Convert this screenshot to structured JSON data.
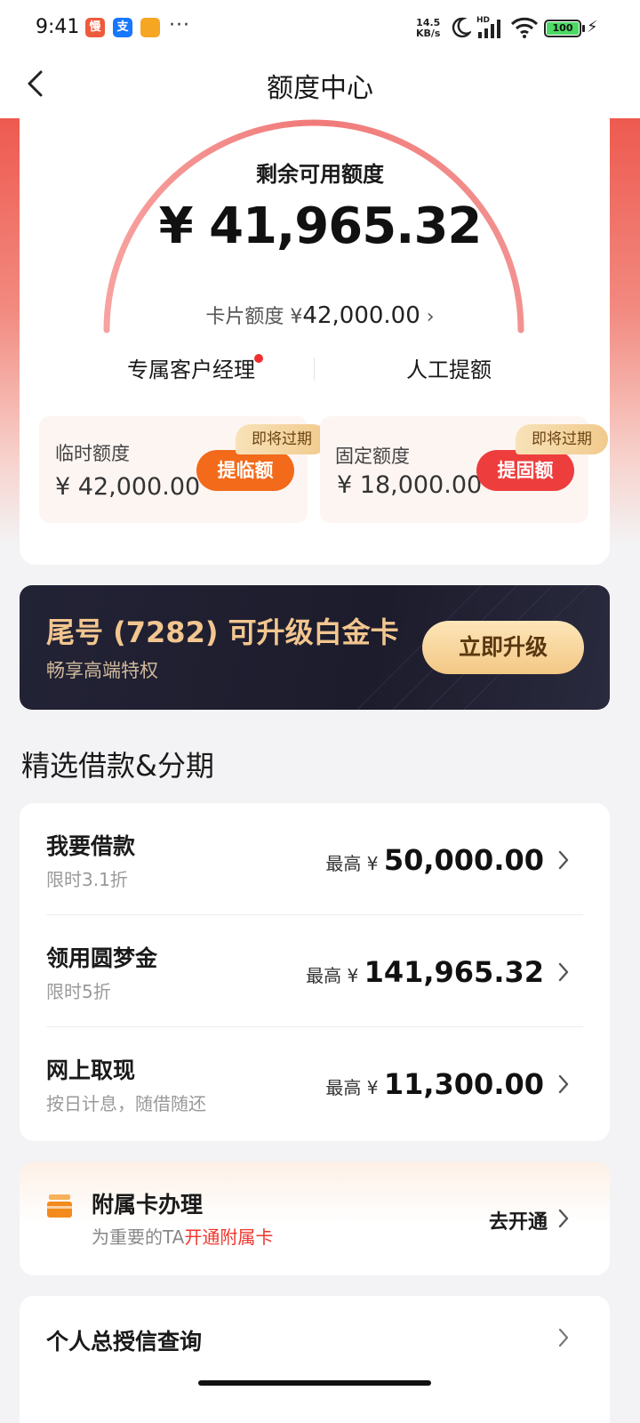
{
  "status_bar": {
    "time": "9:41",
    "apps": [
      {
        "icon": "app-tile-red-icon",
        "glyph": "慢",
        "color": "#ee5a3c"
      },
      {
        "icon": "alipay-icon",
        "glyph": "支",
        "color": "#1677ff"
      },
      {
        "icon": "app-tile-orange-icon",
        "glyph": "",
        "color": "#f5a623"
      }
    ],
    "more": "···",
    "net_speed_value": "14.5",
    "net_speed_unit": "KB/s",
    "signal_label": "HD",
    "battery": "100"
  },
  "nav": {
    "title": "额度中心",
    "back_icon": "chevron-left-icon"
  },
  "quota": {
    "remain_label": "剩余可用额度",
    "remain_amount": "¥ 41,965.32",
    "card_limit_label": "卡片额度 ¥",
    "card_limit_amount": "42,000.00",
    "card_limit_chevron": "›",
    "manager_label": "专属客户经理",
    "manual_raise_label": "人工提额"
  },
  "temp_quota": {
    "label": "临时额度",
    "amount": "¥ 42,000.00",
    "button": "提临额",
    "tag": "即将过期",
    "button_color": "#f26a1a"
  },
  "fixed_quota": {
    "label": "固定额度",
    "amount": "¥ 18,000.00",
    "button": "提固额",
    "tag": "即将过期",
    "button_color": "#ee3d3d"
  },
  "upgrade": {
    "title": "尾号 (7282) 可升级白金卡",
    "subtitle": "畅享高端特权",
    "button": "立即升级"
  },
  "section_title": "精选借款&分期",
  "loans": [
    {
      "title": "我要借款",
      "subtitle": "限时3.1折",
      "prefix": "最高 ¥ ",
      "amount": "50,000.00"
    },
    {
      "title": "领用圆梦金",
      "subtitle": "限时5折",
      "prefix": "最高 ¥ ",
      "amount": "141,965.32"
    },
    {
      "title": "网上取现",
      "subtitle": "按日计息，随借随还",
      "prefix": "最高 ¥ ",
      "amount": "11,300.00"
    }
  ],
  "supplementary": {
    "title": "附属卡办理",
    "subtitle_prefix": "为重要的TA",
    "subtitle_highlight": "开通附属卡",
    "action": "去开通"
  },
  "credit_query": {
    "title": "个人总授信查询"
  }
}
